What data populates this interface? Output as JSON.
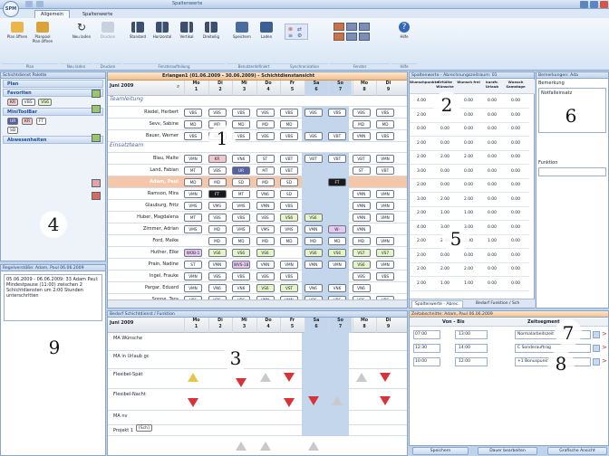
{
  "app": {
    "logo_text": "SPM",
    "window_title": "Spaltenwerte"
  },
  "ribbon": {
    "tabs": [
      "Allgemein",
      "Spaltenwerte"
    ],
    "buttons": [
      {
        "label": "Plan öffnen",
        "icon": "folder-icon"
      },
      {
        "label": "Planpool Plan öffnen",
        "icon": "folder-pool-icon"
      },
      {
        "label": "Neu laden",
        "icon": "refresh-icon"
      },
      {
        "label": "Drucken",
        "icon": "printer-icon"
      },
      {
        "label": "Standard",
        "icon": "layout-standard-icon"
      },
      {
        "label": "Horizontal",
        "icon": "layout-horizontal-icon"
      },
      {
        "label": "Vertikal",
        "icon": "layout-vertical-icon"
      },
      {
        "label": "Dreiteilig",
        "icon": "layout-three-icon"
      },
      {
        "label": "Speichern",
        "icon": "save-icon"
      },
      {
        "label": "Laden",
        "icon": "load-icon"
      },
      {
        "label": "Hilfe",
        "icon": "help-icon"
      }
    ],
    "groups": [
      "Plan",
      "Neu laden",
      "Drucken",
      "Fensteraufteilung",
      "Benutzerdefiniert",
      "Synchronisation",
      "Fenster",
      "Hilfe"
    ]
  },
  "palette": {
    "title": "Schichtdienst Palette",
    "sections": [
      {
        "name": "Plan",
        "chips": []
      },
      {
        "name": "Favoriten",
        "chips": [
          "KR",
          "VBS",
          "VS6"
        ]
      },
      {
        "name": "MiniToolBar",
        "chips": [
          "UR",
          "KR",
          "FT",
          "SD"
        ]
      },
      {
        "name": "Abwesenheiten",
        "chips": []
      }
    ]
  },
  "rules": {
    "title": "Regelverstöße: Adam, Paul 06.06.2009",
    "text": "05.06.2009 - 06.06.2009: 33 Adam Paul: Mindestpause (11:00) zwischen 2 Schichtdiensten um 2:00 Stunden unterschritten"
  },
  "schedule": {
    "tab_title": "Erlangen1 (01.06.2009 - 30.06.2009) - Schichtdienstansicht",
    "month": "Juni 2009",
    "days": [
      {
        "dow": "Mo",
        "num": "1"
      },
      {
        "dow": "Di",
        "num": "2"
      },
      {
        "dow": "Mi",
        "num": "3"
      },
      {
        "dow": "Do",
        "num": "4"
      },
      {
        "dow": "Fr",
        "num": "5"
      },
      {
        "dow": "Sa",
        "num": "6"
      },
      {
        "dow": "So",
        "num": "7"
      },
      {
        "dow": "Mo",
        "num": "8"
      },
      {
        "dow": "Di",
        "num": "9"
      }
    ],
    "groups": [
      {
        "name": "Teamleitung",
        "rows": [
          {
            "name": "Riedel, Herbert",
            "cells": [
              "VBS",
              "VBS",
              "VBS",
              "VBS",
              "VBS",
              "VBS",
              "VBS",
              "VBS",
              "VBS"
            ]
          },
          {
            "name": "Sevv, Sabine",
            "cells": [
              "MD",
              "MD",
              "MD",
              "MD",
              "MD",
              "",
              "",
              "MD",
              "MD"
            ]
          },
          {
            "name": "Bauer, Werner",
            "cells": [
              "VBS",
              "VBS",
              "VBS",
              "VBS",
              "VBS",
              "VBS",
              "VBT",
              "VMN",
              "VBS"
            ]
          }
        ]
      },
      {
        "name": "Einsatzteam",
        "rows": [
          {
            "name": "Blau, Malte",
            "cells": [
              "VMN",
              "KR",
              "VN6",
              "ST",
              "VBT",
              "VBT",
              "VBT",
              "VBT",
              "VMN"
            ]
          },
          {
            "name": "Land, Fabian",
            "cells": [
              "MT",
              "VBS",
              "UR",
              "MT",
              "VBT",
              "",
              "",
              "ST",
              "VBT"
            ]
          },
          {
            "name": "Adam, Paul",
            "cells": [
              "MD",
              "MD",
              "SD",
              "MD",
              "SD",
              "",
              "FT",
              "",
              ""
            ]
          },
          {
            "name": "Ramson, Mira",
            "cells": [
              "VMN",
              "FT",
              "MT",
              "VN6",
              "SD",
              "",
              "",
              "VMN",
              "VMN"
            ]
          },
          {
            "name": "Glauburg, Fritz",
            "cells": [
              "VMS",
              "VMS",
              "VMS",
              "VMN",
              "VBS",
              "",
              "",
              "VMN",
              "VMN"
            ]
          },
          {
            "name": "Huber, Magdalena",
            "cells": [
              "MT",
              "VBS",
              "VBS",
              "VBS",
              "VS6",
              "VS6",
              "",
              "VMN",
              "VMN"
            ]
          },
          {
            "name": "Zimmer, Adrian",
            "cells": [
              "VMS",
              "MD",
              "VMS",
              "VMS",
              "VMS",
              "VMN",
              "W-",
              "VMN",
              ""
            ]
          },
          {
            "name": "Ford, Maike",
            "cells": [
              "",
              "MD",
              "MD",
              "MD",
              "MD",
              "MD",
              "MD",
              "MD",
              "VMN"
            ]
          },
          {
            "name": "Huther, Elke",
            "cells": [
              "WOB-1",
              "VS6",
              "VS6",
              "VS6",
              "",
              "VS6",
              "VS6",
              "VS7",
              "VS7"
            ]
          },
          {
            "name": "Prain, Nadine",
            "cells": [
              "ST",
              "VMN",
              "WVS-18",
              "VMN",
              "VMN",
              "VMN",
              "VMN",
              "VS6",
              "VMN"
            ]
          },
          {
            "name": "Ingel, Frauke",
            "cells": [
              "VMN",
              "VBS",
              "VBS",
              "VBS",
              "VBS",
              "",
              "",
              "VBS",
              "VBS"
            ]
          },
          {
            "name": "Pargar, Eduard",
            "cells": [
              "VMN",
              "VN6",
              "VN6",
              "VS6",
              "VST",
              "VN6",
              "VN6",
              "VN6",
              ""
            ]
          },
          {
            "name": "Sonne, Tara",
            "cells": [
              "VBS",
              "VBS",
              "VBS",
              "VMN",
              "VMN",
              "VBS",
              "VBS",
              "VBS",
              "VBS"
            ]
          }
        ]
      }
    ]
  },
  "spalten": {
    "title": "Spaltenwerte - Abrechnungszeitraum: 01",
    "headers": [
      "Wunschpunkte",
      "Erfüllte Wünsche",
      "Wunsch frei",
      "kurzfr. Urlaub",
      "Wunsch Samstage"
    ],
    "rows": [
      [
        "4.00",
        "2.00",
        "0.00",
        "0.00",
        "0.00"
      ],
      [
        "2.00",
        "0.00",
        "0.00",
        "0.00",
        "0.00"
      ],
      [
        "0.00",
        "0.00",
        "0.00",
        "0.00",
        "0.00"
      ],
      [
        "2.00",
        "0.00",
        "0.00",
        "0.00",
        "0.00"
      ],
      [
        "2.00",
        "2.00",
        "2.00",
        "0.00",
        "0.00"
      ],
      [
        "3.00",
        "0.00",
        "0.00",
        "0.00",
        "0.00"
      ],
      [
        "2.00",
        "0.00",
        "0.00",
        "0.00",
        "0.00"
      ],
      [
        "3.00",
        "2.00",
        "2.00",
        "0.00",
        "0.00"
      ],
      [
        "2.00",
        "1.00",
        "1.00",
        "0.00",
        "0.00"
      ],
      [
        "4.00",
        "3.00",
        "3.00",
        "0.00",
        "0.00"
      ],
      [
        "2.00",
        "2.00",
        "2.00",
        "1.00",
        "0.00"
      ],
      [
        "2.00",
        "0.00",
        "0.00",
        "0.00",
        "0.00"
      ],
      [
        "2.00",
        "2.00",
        "2.00",
        "0.00",
        "0.00"
      ],
      [
        "2.00",
        "1.00",
        "1.00",
        "0.00",
        "0.00"
      ]
    ],
    "bottom_tabs": [
      "Spaltenwerte - Abrec.",
      "Bedarf Funktion / Sch"
    ]
  },
  "remarks": {
    "title": "Bemerkungen: Ada",
    "label": "Bemerkung",
    "value": "Notfalleinsatz",
    "func_label": "Funktion"
  },
  "need": {
    "title": "Bedarf Schichtdienst / Funktion",
    "month": "Juni 2009",
    "rows": [
      "MA Wünsche",
      "MA in Urlaub gc",
      "Flexibel-Spät",
      "Flexibel-Nacht",
      "MA nv",
      "Projekt 1"
    ],
    "sub_chip": "[Sch]"
  },
  "detail": {
    "title": "Zeitabschnitte: Adam, Paul 06.06.2009",
    "col_time": "Von - Bis",
    "col_type": "Zeitsegment",
    "rows": [
      {
        "from": "07:00",
        "to": "13:00",
        "type": "Normalarbeitszeit"
      },
      {
        "from": "12:30",
        "to": "14:00",
        "type": "C Sonderauftrag"
      },
      {
        "from": "10:00",
        "to": "12:00",
        "type": "+1 Bonuspunkt"
      }
    ]
  },
  "bottom_buttons": [
    "Speichern",
    "Dauer bearbeiten",
    "Grafische Ansicht"
  ],
  "callouts": [
    "1",
    "2",
    "3",
    "4",
    "5",
    "6",
    "7",
    "8",
    "9"
  ]
}
